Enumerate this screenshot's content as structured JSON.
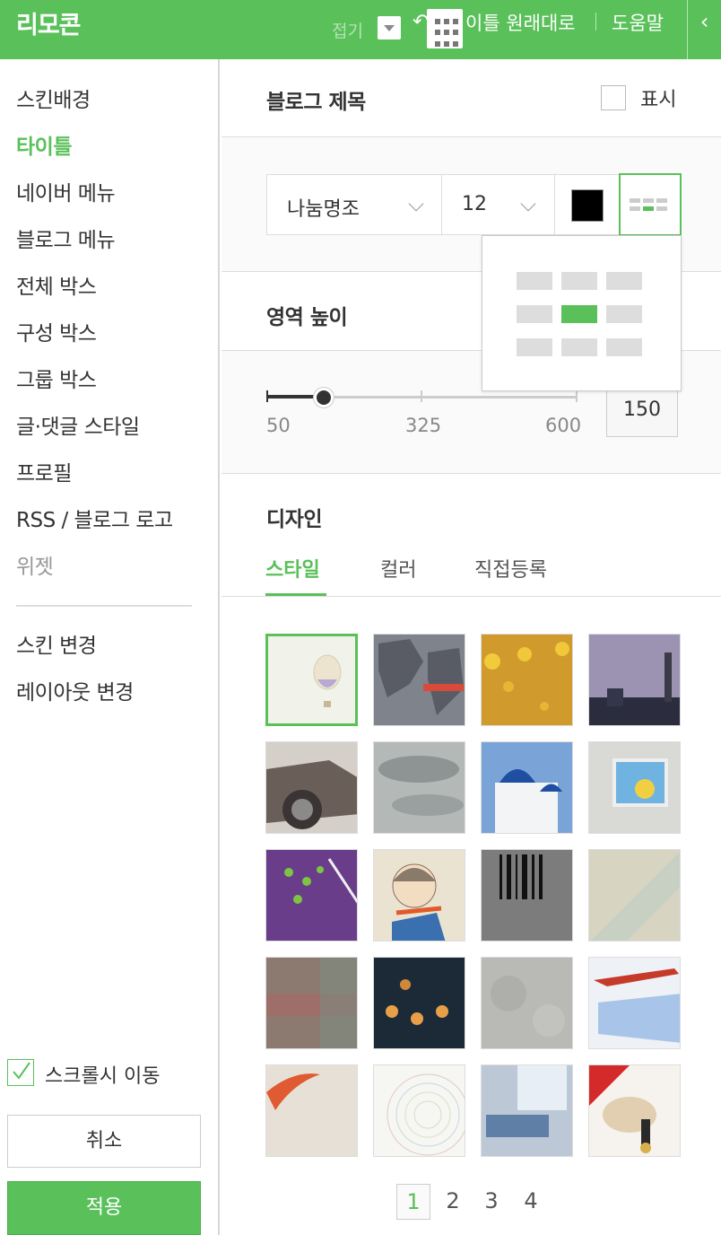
{
  "header": {
    "title": "리모콘",
    "fold_label": "접기",
    "undo_label": "↶",
    "reset_label": "이틀 원래대로",
    "help_label": "도움말",
    "collapse_label": "‹"
  },
  "sidebar": {
    "items": [
      {
        "label": "스킨배경"
      },
      {
        "label": "타이틀"
      },
      {
        "label": "네이버 메뉴"
      },
      {
        "label": "블로그 메뉴"
      },
      {
        "label": "전체 박스"
      },
      {
        "label": "구성 박스"
      },
      {
        "label": "그룹 박스"
      },
      {
        "label": "글·댓글 스타일"
      },
      {
        "label": "프로필"
      },
      {
        "label": "RSS / 블로그 로고"
      },
      {
        "label": "위젯"
      }
    ],
    "extra_items": [
      {
        "label": "스킨 변경"
      },
      {
        "label": "레이아웃 변경"
      }
    ],
    "scroll_follow_label": "스크롤시 이동",
    "scroll_follow_checked": true,
    "cancel_label": "취소",
    "apply_label": "적용"
  },
  "blog_title": {
    "heading": "블로그 제목",
    "show_label": "표시",
    "show_checked": false,
    "font_value": "나눔명조",
    "size_value": "12",
    "color": "#000000",
    "alignment": "center"
  },
  "area_height": {
    "heading": "영역 높이",
    "ticks": [
      "50",
      "325",
      "600"
    ],
    "value": "150"
  },
  "design": {
    "heading": "디자인",
    "tabs": [
      {
        "label": "스타일"
      },
      {
        "label": "컬러"
      },
      {
        "label": "직접등록"
      }
    ],
    "active_tab": "스타일",
    "selected_index": 0,
    "pages": [
      "1",
      "2",
      "3",
      "4"
    ],
    "current_page": "1"
  },
  "colors": {
    "accent": "#5ac05a"
  }
}
